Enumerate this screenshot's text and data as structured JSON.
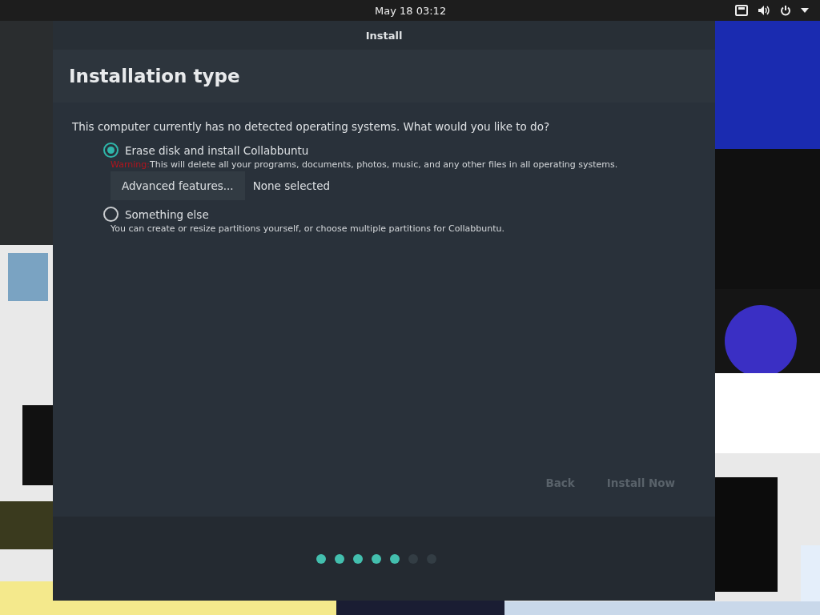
{
  "top_bar": {
    "clock": "May 18  03:12"
  },
  "window": {
    "title": "Install",
    "heading": "Installation type",
    "question": "This computer currently has no detected operating systems. What would you like to do?",
    "options": [
      {
        "label": "Erase disk and install Collabbuntu",
        "selected": true,
        "warning": "Warning:",
        "note": "This will delete all your programs, documents, photos, music, and any other files in all operating systems.",
        "advanced_button": "Advanced features...",
        "advanced_status": "None selected"
      },
      {
        "label": "Something else",
        "selected": false,
        "note": "You can create or resize partitions yourself, or choose multiple partitions for Collabbuntu."
      }
    ],
    "buttons": [
      {
        "label": "Back",
        "disabled": true
      },
      {
        "label": "Install Now",
        "disabled": true
      }
    ],
    "steps": [
      {
        "completed": true
      },
      {
        "completed": true
      },
      {
        "completed": true
      },
      {
        "completed": true
      },
      {
        "completed": true
      },
      {
        "completed": false
      },
      {
        "completed": false
      }
    ]
  }
}
